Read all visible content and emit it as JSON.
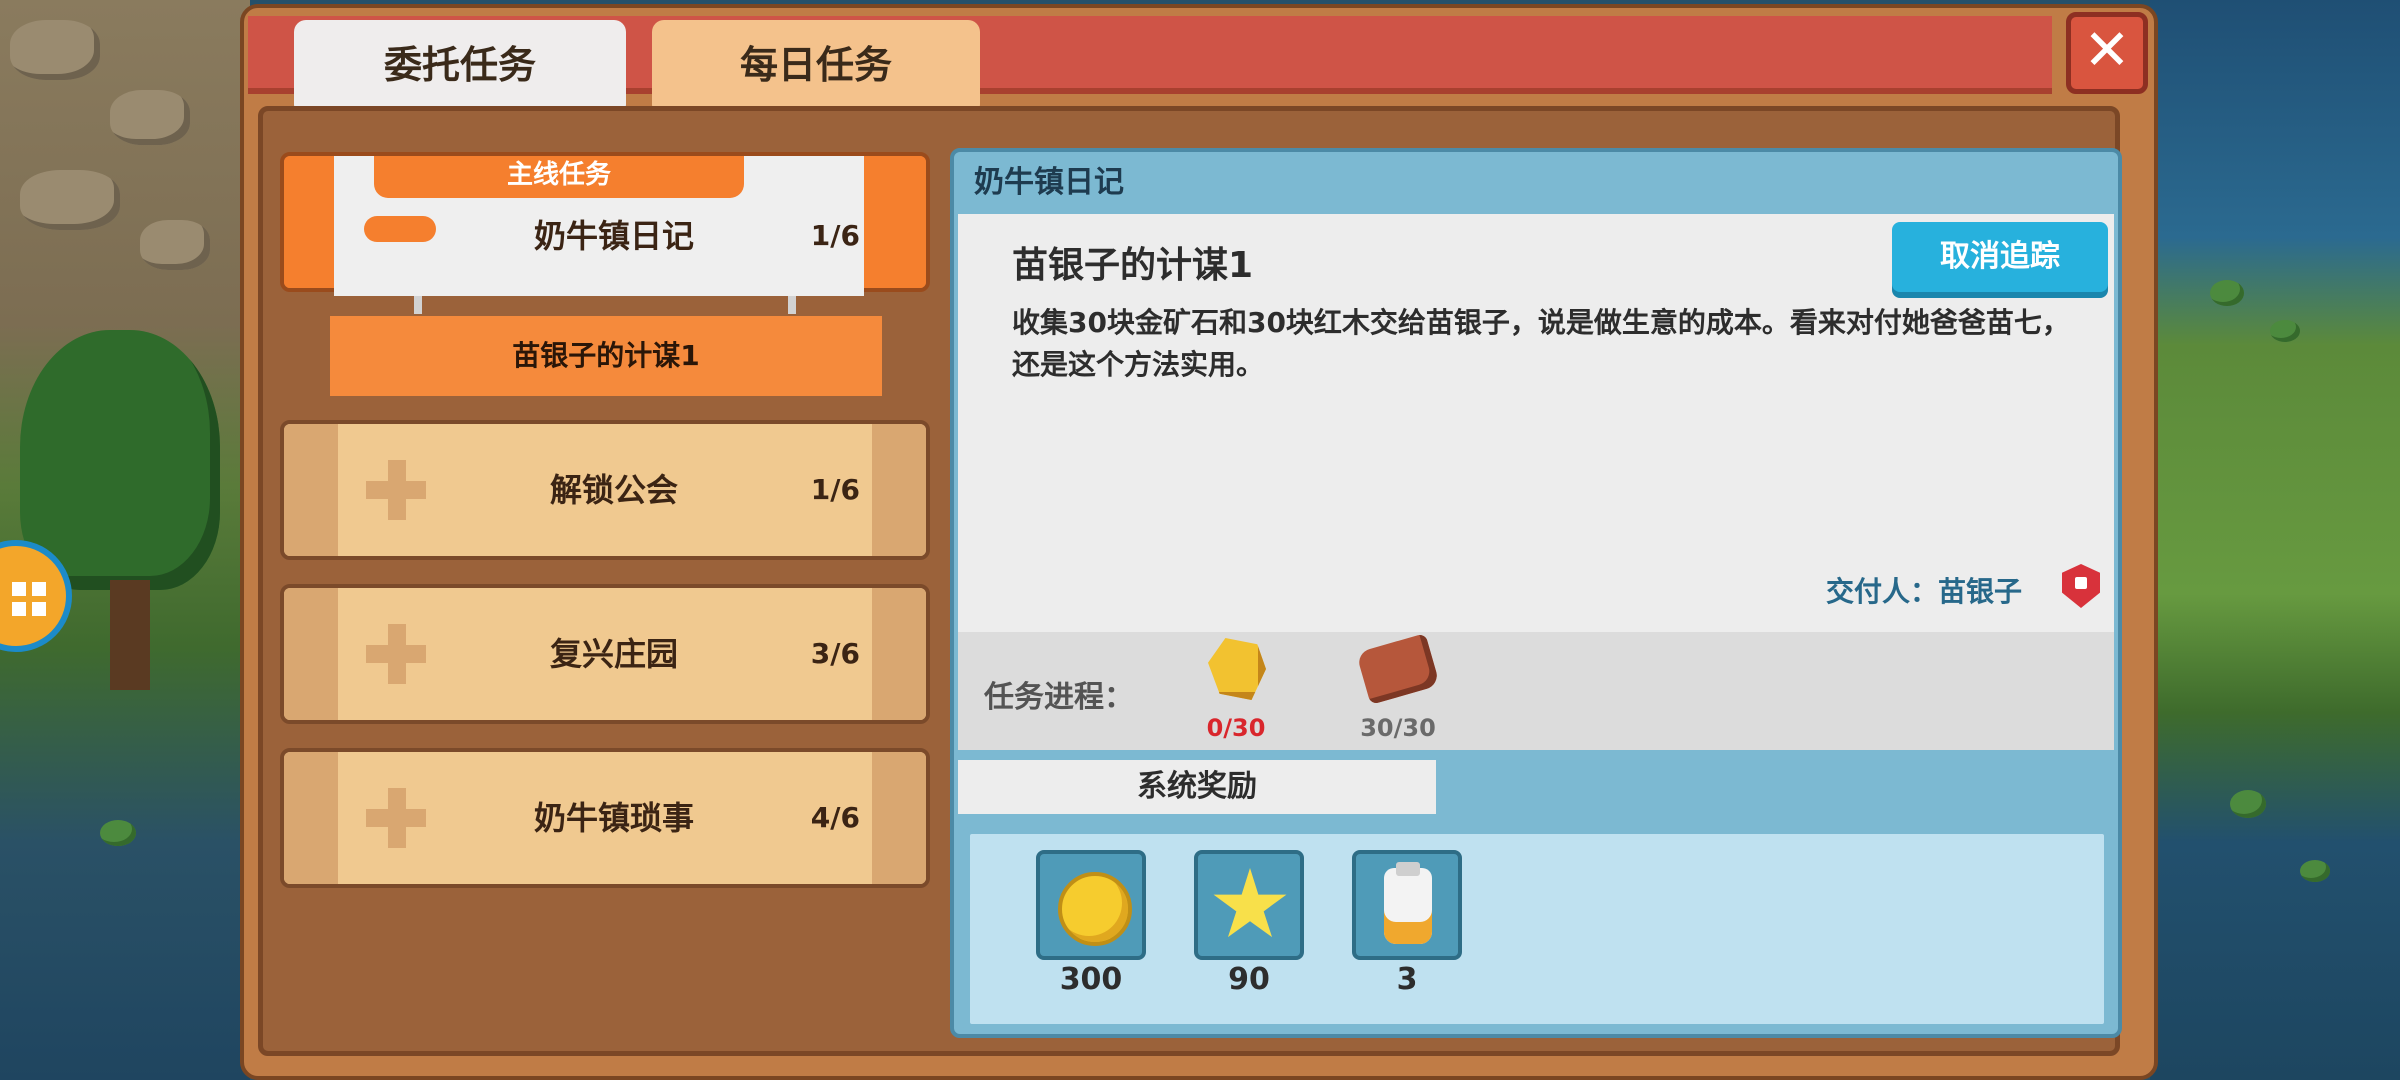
{
  "tabs": {
    "commission": "委托任务",
    "daily": "每日任务"
  },
  "close_icon": "close-x-icon",
  "quests": [
    {
      "ribbon": "主线任务",
      "name": "奶牛镇日记",
      "progress": "1/6",
      "expanded": true
    },
    {
      "name": "解锁公会",
      "progress": "1/6"
    },
    {
      "name": "复兴庄园",
      "progress": "3/6"
    },
    {
      "name": "奶牛镇琐事",
      "progress": "4/6"
    }
  ],
  "sub_quest": "苗银子的计谋1",
  "detail": {
    "header": "奶牛镇日记",
    "title": "苗银子的计谋1",
    "description": "收集30块金矿石和30块红木交给苗银子，说是做生意的成本。看来对付她爸爸苗七，还是这个方法实用。",
    "untrack_button": "取消追踪",
    "giver": "交付人：苗银子",
    "progress_label": "任务进程：",
    "requirements": [
      {
        "icon": "gold-ore-icon",
        "count": "0/30",
        "status_color": "#d9262c"
      },
      {
        "icon": "red-wood-icon",
        "count": "30/30",
        "status_color": "#6a6a6a"
      }
    ],
    "reward_tab": "系统奖励",
    "rewards": [
      {
        "icon": "gold-coin-icon",
        "amount": "300"
      },
      {
        "icon": "star-icon",
        "amount": "90"
      },
      {
        "icon": "milk-bottle-icon",
        "amount": "3"
      }
    ]
  },
  "colors": {
    "top_bar": "#cf5447",
    "frame": "#c07c46",
    "main_quest": "#f57f2e",
    "detail_accent": "#7cb9d2",
    "untrack_button": "#27b1dd"
  }
}
